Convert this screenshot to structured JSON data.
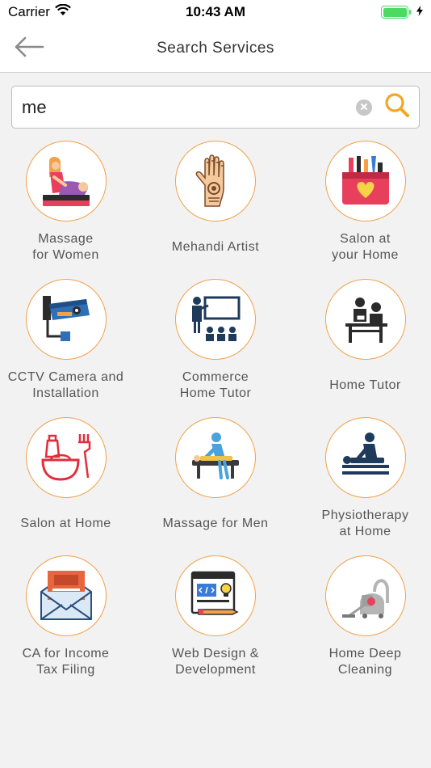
{
  "status_bar": {
    "carrier": "Carrier",
    "time": "10:43 AM",
    "battery_level": 1.0
  },
  "nav": {
    "title": "Search Services",
    "back_icon": "arrow-left-icon"
  },
  "search": {
    "value": "me",
    "clear_icon": "clear-circle-icon",
    "search_icon": "magnifier-icon"
  },
  "colors": {
    "accent": "#f2a14a",
    "background": "#f2f2f2",
    "battery": "#4cd964",
    "cursor": "#3b6df0"
  },
  "services": [
    {
      "label": "Massage\nfor Women",
      "icon": "massage-women-icon"
    },
    {
      "label": "Mehandi Artist",
      "icon": "henna-hand-icon"
    },
    {
      "label": "Salon at\nyour Home",
      "icon": "cosmetic-bag-icon"
    },
    {
      "label": "CCTV Camera and\nInstallation",
      "icon": "cctv-camera-icon"
    },
    {
      "label": "Commerce\nHome Tutor",
      "icon": "classroom-icon"
    },
    {
      "label": "Home Tutor",
      "icon": "tutor-desk-icon"
    },
    {
      "label": "Salon at Home",
      "icon": "salon-bowl-icon"
    },
    {
      "label": "Massage for Men",
      "icon": "massage-men-icon"
    },
    {
      "label": "Physiotherapy\nat Home",
      "icon": "physiotherapy-icon"
    },
    {
      "label": "CA for Income\nTax Filing",
      "icon": "tax-envelope-icon"
    },
    {
      "label": "Web Design &\nDevelopment",
      "icon": "web-design-icon"
    },
    {
      "label": "Home Deep\nCleaning",
      "icon": "vacuum-cleaner-icon"
    }
  ]
}
